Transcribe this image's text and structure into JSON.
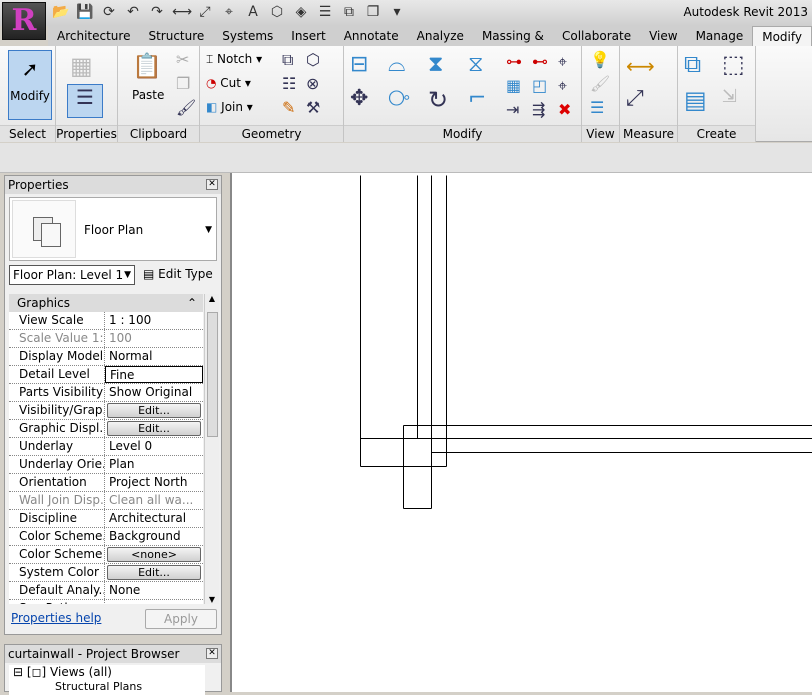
{
  "app": {
    "title": "Autodesk Revit 2013",
    "logo": "R"
  },
  "qat": [
    "open-icon",
    "save-icon",
    "sync-icon",
    "undo-icon",
    "redo-icon",
    "aligned-dimension-icon",
    "measure-icon",
    "tag-icon",
    "text-icon",
    "3d-view-icon",
    "section-icon",
    "thin-lines-icon",
    "close-hidden-icon",
    "switch-windows-icon",
    "customize-icon"
  ],
  "tabs": [
    {
      "label": "Architecture"
    },
    {
      "label": "Structure"
    },
    {
      "label": "Systems"
    },
    {
      "label": "Insert"
    },
    {
      "label": "Annotate"
    },
    {
      "label": "Analyze"
    },
    {
      "label": "Massing & Site"
    },
    {
      "label": "Collaborate"
    },
    {
      "label": "View"
    },
    {
      "label": "Manage"
    },
    {
      "label": "Modify",
      "active": true
    }
  ],
  "ribbon": {
    "select": {
      "label": "Select",
      "modify": "Modify"
    },
    "properties": {
      "label": "Properties"
    },
    "clipboard": {
      "label": "Clipboard",
      "paste": "Paste"
    },
    "geometry": {
      "label": "Geometry",
      "notch": "Notch",
      "cut": "Cut",
      "join": "Join"
    },
    "modify": {
      "label": "Modify"
    },
    "view": {
      "label": "View"
    },
    "measure": {
      "label": "Measure"
    },
    "create": {
      "label": "Create"
    }
  },
  "properties": {
    "title": "Properties",
    "type_name": "Floor Plan",
    "instance": "Floor Plan: Level 1",
    "edit_type": "Edit Type",
    "group": "Graphics",
    "rows": [
      {
        "k": "View Scale",
        "v": "1 : 100"
      },
      {
        "k": "Scale Value    1:",
        "v": "100",
        "disabled": true
      },
      {
        "k": "Display Model",
        "v": "Normal"
      },
      {
        "k": "Detail Level",
        "v": "Fine",
        "selected": true
      },
      {
        "k": "Parts Visibility",
        "v": "Show Original"
      },
      {
        "k": "Visibility/Grap...",
        "v": "Edit...",
        "button": true
      },
      {
        "k": "Graphic Displ...",
        "v": "Edit...",
        "button": true
      },
      {
        "k": "Underlay",
        "v": "Level 0"
      },
      {
        "k": "Underlay Orie...",
        "v": "Plan"
      },
      {
        "k": "Orientation",
        "v": "Project North"
      },
      {
        "k": "Wall Join Disp...",
        "v": "Clean all wa...",
        "disabled": true
      },
      {
        "k": "Discipline",
        "v": "Architectural"
      },
      {
        "k": "Color Scheme...",
        "v": "Background"
      },
      {
        "k": "Color Scheme",
        "v": "<none>",
        "button": true
      },
      {
        "k": "System Color ...",
        "v": "Edit...",
        "button": true
      },
      {
        "k": "Default Analy...",
        "v": "None"
      },
      {
        "k": "Sun Path",
        "v": ""
      }
    ],
    "help": "Properties help",
    "apply": "Apply"
  },
  "browser": {
    "title": "curtainwall - Project Browser",
    "root": "Views (all)",
    "child": "Structural Plans"
  }
}
